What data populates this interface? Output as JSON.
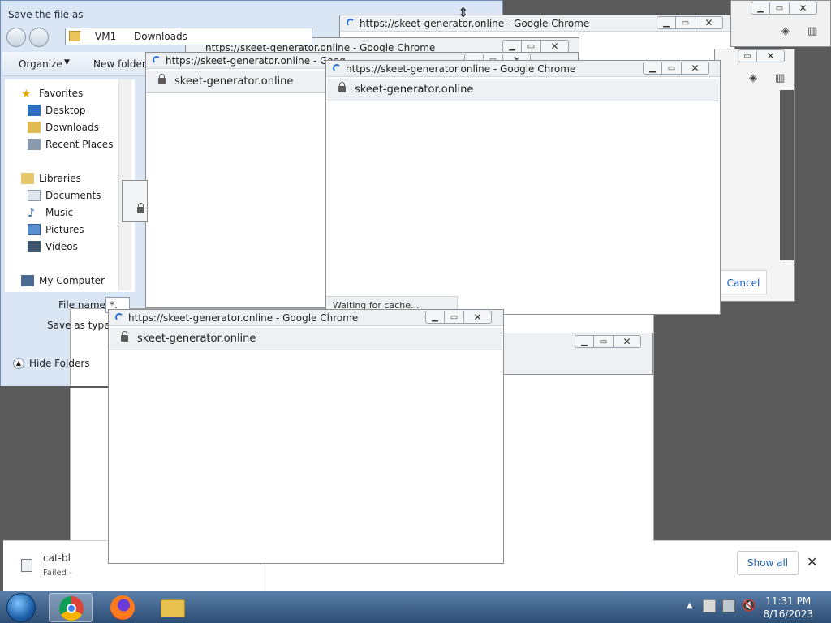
{
  "save_dialog": {
    "title": "Save the file as",
    "breadcrumb": [
      "VM1",
      "Downloads"
    ],
    "toolbar": {
      "organize": "Organize",
      "new_folder": "New folder"
    },
    "nav": {
      "favorites": "Favorites",
      "desktop": "Desktop",
      "downloads": "Downloads",
      "recent": "Recent Places",
      "libraries": "Libraries",
      "documents": "Documents",
      "music": "Music",
      "pictures": "Pictures",
      "videos": "Videos",
      "computer": "My Computer"
    },
    "file_name_label": "File name:",
    "file_name_value": "*.",
    "save_as_type_label": "Save as type:",
    "hide_folders": "Hide Folders",
    "cancel": "Cancel"
  },
  "chrome_windows": {
    "title": "https://skeet-generator.online - Google Chrome",
    "url": "skeet-generator.online",
    "status": "Waiting for cache...",
    "truncated_title": "https://skeet-generator.online - Goog"
  },
  "downloads_shelf": {
    "file_name": "cat-bl",
    "file_status": "Failed -",
    "show_all": "Show all"
  },
  "taskbar": {
    "time": "11:31 PM",
    "date": "8/16/2023"
  },
  "colors": {
    "taskbar": "#3b5f8a",
    "dialog_bg": "#dbe6f4",
    "cancel_text": "#1a5fb4"
  }
}
